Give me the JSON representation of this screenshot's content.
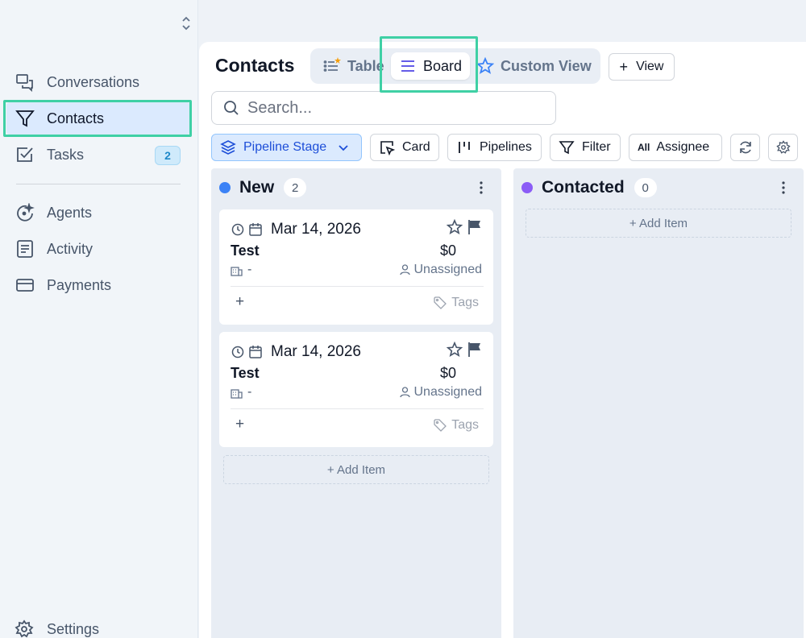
{
  "sidebar": {
    "items": [
      {
        "label": "Conversations"
      },
      {
        "label": "Contacts"
      },
      {
        "label": "Tasks",
        "badge": "2"
      },
      {
        "label": "Agents"
      },
      {
        "label": "Activity"
      },
      {
        "label": "Payments"
      },
      {
        "label": "Settings"
      }
    ]
  },
  "header": {
    "title": "Contacts",
    "tabs": [
      {
        "label": "Table"
      },
      {
        "label": "Board"
      },
      {
        "label": "Custom View"
      }
    ],
    "add_view_label": "View"
  },
  "search": {
    "placeholder": "Search..."
  },
  "toolbar": {
    "pipeline_stage": "Pipeline Stage",
    "card": "Card",
    "pipelines": "Pipelines",
    "filter": "Filter",
    "assignee_prefix": "All",
    "assignee": "Assignee"
  },
  "board": {
    "columns": [
      {
        "title": "New",
        "count": "2",
        "color": "#3b82f6",
        "cards": [
          {
            "date": "Mar 14, 2026",
            "name": "Test",
            "amount": "$0",
            "company": "-",
            "assignee": "Unassigned",
            "add": "+",
            "tags": "Tags"
          },
          {
            "date": "Mar 14, 2026",
            "name": "Test",
            "amount": "$0",
            "company": "-",
            "assignee": "Unassigned",
            "add": "+",
            "tags": "Tags"
          }
        ],
        "add_item": "+ Add Item"
      },
      {
        "title": "Contacted",
        "count": "0",
        "color": "#8b5cf6",
        "cards": [],
        "add_item": "+ Add Item"
      }
    ]
  },
  "colors": {
    "highlight": "#3fd0a5",
    "accent": "#1d4ed8"
  }
}
